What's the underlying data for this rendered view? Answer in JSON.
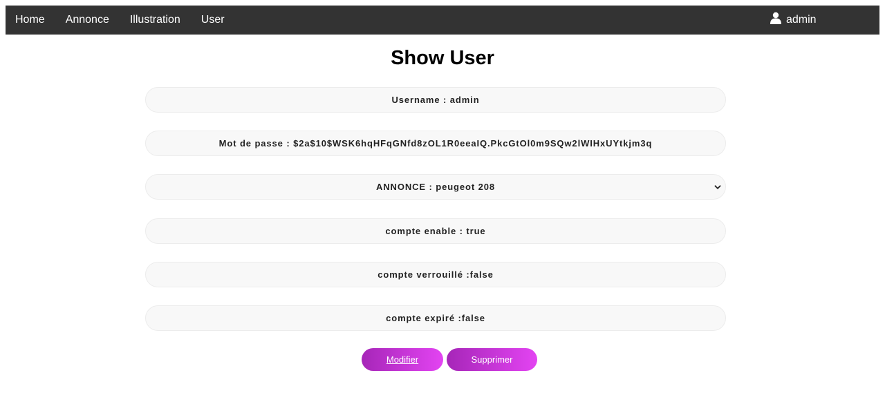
{
  "nav": {
    "links": [
      "Home",
      "Annonce",
      "Illustration",
      "User"
    ],
    "user_label": "admin",
    "user_icon": "user-icon"
  },
  "page": {
    "title": "Show User"
  },
  "fields": {
    "username": {
      "label": "Username :",
      "value": "admin"
    },
    "password": {
      "label": "Mot de passe :",
      "value": "$2a$10$WSK6hqHFqGNfd8zOL1R0eeaIQ.PkcGtOl0m9SQw2lWIHxUYtkjm3q"
    },
    "annonce": {
      "label": "ANNONCE :",
      "value": "peugeot 208"
    },
    "enabled": {
      "label": "compte enable :",
      "value": "true"
    },
    "locked": {
      "label": "compte verrouillé :",
      "value": "false"
    },
    "expired": {
      "label": "compte expiré :",
      "value": "false"
    }
  },
  "actions": {
    "modify_label": "Modifier",
    "delete_label": "Supprimer"
  },
  "colors": {
    "navbar": "#333333",
    "field_bg": "#f8f8f8",
    "button_gradient_start": "#a626b8",
    "button_gradient_end": "#e344f2"
  }
}
